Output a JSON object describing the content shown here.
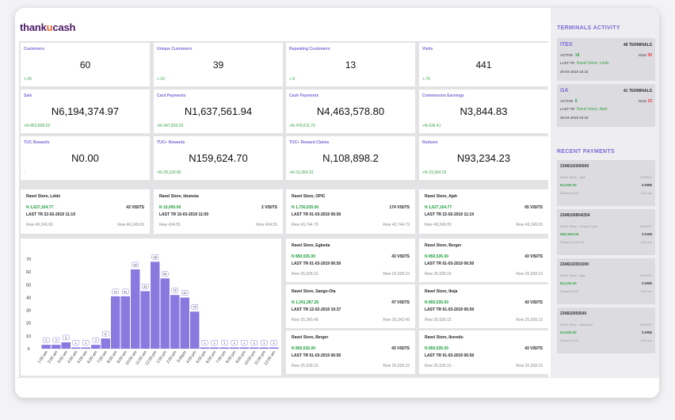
{
  "brand": {
    "logo_pre": "thank",
    "logo_mark": "u",
    "logo_post": "cash"
  },
  "stats": [
    {
      "label": "Customers",
      "value": "60",
      "change": "+.20"
    },
    {
      "label": "Unique Customers",
      "value": "39",
      "change": "+.16"
    },
    {
      "label": "Repeating Customers",
      "value": "13",
      "change": "+.9"
    },
    {
      "label": "Visits",
      "value": "441",
      "change": "+.76"
    },
    {
      "label": "Sale",
      "value": "N6,194,374.97",
      "change": "+N-853,809.02"
    },
    {
      "label": "Card Payments",
      "value": "N1,637,561.94",
      "change": "+N-347,833.03"
    },
    {
      "label": "Cash Payments",
      "value": "N4,463,578.80",
      "change": "+N-479,611.76"
    },
    {
      "label": "Commission Earnings",
      "value": "N3,844.83",
      "change": "+N-636.41"
    },
    {
      "label": "TUC Rewards",
      "value": "N0.00",
      "change": "-"
    },
    {
      "label": "TUC+ Rewards",
      "value": "N159,624.70",
      "change": "+N-28,100.90"
    },
    {
      "label": "TUC+ Reward Claims",
      "value": "N,108,898.2",
      "change": "+N-33,364.23"
    },
    {
      "label": "Redeem",
      "value": "N93,234.23",
      "change": "+N-33,364.23"
    }
  ],
  "top_stores": [
    {
      "name": "Ravel Store, Lekki",
      "amount": "N 1,627,104.77",
      "visits": "43 VISITS",
      "last": "LAST TR  22-02-2019 11:19",
      "rew_l": "Rew 49,249.00",
      "rew_r": "Rew 49,249.00"
    },
    {
      "name": "Ravel Store, Idumota",
      "amount": "N 15,000.00",
      "visits": "2 VISITS",
      "last": "LAST TR  15-03-2019 11:59",
      "rew_l": "Rew 434.55",
      "rew_r": "Rew 434.55"
    },
    {
      "name": "Ravel Store, OPIC",
      "amount": "N 1,750,535.00",
      "visits": "174 VISITS",
      "last": "LAST TR  01-03-2019 06:50",
      "rew_l": "Rew 43,744.79",
      "rew_r": "Rew 43,744.79"
    },
    {
      "name": "Ravel Store, Ajah",
      "amount": "N 1,627,104.77",
      "visits": "65 VISITS",
      "last": "LAST TR  22-02-2019 11:19",
      "rew_l": "Rew 49,249.00",
      "rew_r": "Rew 49,249.00"
    }
  ],
  "grid_stores": [
    {
      "name": "Ravel Store, Egbeda",
      "amount": "N 850,535.00",
      "visits": "43 VISITS",
      "last": "LAST TR  01-03-2019 06:50",
      "rew_l": "Rew 25,928.15",
      "rew_r": "Rew 25,928.15"
    },
    {
      "name": "Ravel Store, Berger",
      "amount": "N 850,535.00",
      "visits": "43 VISITS",
      "last": "LAST TR  01-03-2019 06:50",
      "rew_l": "Rew 25,928.15",
      "rew_r": "Rew 25,928.15"
    },
    {
      "name": "Ravel Store, Sango-Ota",
      "amount": "N 1,341,387.26",
      "visits": "47 VISITS",
      "last": "LAST TR  12-02-2019 10:37",
      "rew_l": "Rew 35,343.49",
      "rew_r": "Rew 35,343.49"
    },
    {
      "name": "Ravel Store, Ikeja",
      "amount": "N 850,535.00",
      "visits": "43 VISITS",
      "last": "LAST TR  01-03-2019 06:50",
      "rew_l": "Rew 25,928.15",
      "rew_r": "Rew 25,928.15"
    },
    {
      "name": "Ravel Store, Berger",
      "amount": "N 850,535.00",
      "visits": "43 VISITS",
      "last": "LAST TR  01-03-2019 06:50",
      "rew_l": "Rew 25,928.15",
      "rew_r": "Rew 25,928.15"
    },
    {
      "name": "Ravel Store, Ikorodu",
      "amount": "N 850,535.00",
      "visits": "43 VISITS",
      "last": "LAST TR  01-03-2019 06:50",
      "rew_l": "Rew 25,928.15",
      "rew_r": "Rew 25,928.15"
    }
  ],
  "sidebar": {
    "terminals_title": "TERMINALS ACTIVITY",
    "terminals": [
      {
        "name": "ITEX",
        "count": "48 TERMINALS",
        "active_label": "ACTIVE",
        "active": "18",
        "idle_label": "IDLE",
        "idle": "30",
        "last_label": "LAST TR",
        "last_store": "Ravel Store, Lekki",
        "date": "25-04-2019 15:32"
      },
      {
        "name": "GA",
        "count": "41 TERMINALS",
        "active_label": "ACTIVE",
        "active": "8",
        "idle_label": "IDLE",
        "idle": "33",
        "last_label": "LAST TR",
        "last_store": "Ravel Store, Ajah",
        "date": "25-04-2019 15:32"
      }
    ],
    "payments_title": "RECENT PAYMENTS",
    "payments": [
      {
        "id": "2348102000000",
        "store": "Ravel Store - Ajah",
        "date": "22/05/07",
        "amount": "N4,000.00",
        "method": "CARD",
        "reward": "Reward 0.00",
        "time": "5:32 pm"
      },
      {
        "id": "2348100854l254",
        "store": "Ravel Store - Festac Town",
        "date": "22/05/07",
        "amount": "N82,000.00",
        "method": "CASH",
        "reward": "Reward 3,037.00",
        "time": "5:32 pm"
      },
      {
        "id": "2348102001000",
        "store": "Ravel Store - Ajah",
        "date": "22/05/07",
        "amount": "N3,200.00",
        "method": "CARD",
        "reward": "Reward 0.00",
        "time": "5:32 pm"
      },
      {
        "id": "234810000540",
        "store": "Ravel Store - Maryland",
        "date": "22/05/07",
        "amount": "N3,000.00",
        "method": "CARD",
        "reward": "Reward 0.00",
        "time": "5:32 pm"
      }
    ]
  },
  "colors": {
    "accent": "#7b6bd6",
    "bar": "#8a7ae0",
    "positive": "#3aa34a",
    "negative": "#e33333"
  },
  "chart_data": {
    "type": "bar",
    "categories": [
      "1:00 am",
      "2:00 am",
      "3:00 am",
      "4:00 am",
      "5:00 am",
      "6:00 am",
      "7:00 am",
      "8:00 am",
      "9:00 am",
      "10:00 am",
      "11:00 am",
      "12:00 pm",
      "1:00 pm",
      "2:00 pm",
      "3:00pm",
      "4:00 pm",
      "5:00 pm",
      "6:00 pm",
      "7:00 pm",
      "8:00 pm",
      "9:00 pm",
      "10:00 pm",
      "11:00 pm",
      "12:00 am"
    ],
    "values": [
      3,
      3,
      5,
      1,
      1,
      3,
      8,
      41,
      41,
      62,
      45,
      68,
      55,
      42,
      40,
      29,
      1,
      1,
      1,
      1,
      1,
      1,
      1,
      1
    ],
    "yticks": [
      0,
      10,
      20,
      30,
      40,
      50,
      60,
      70
    ],
    "ylim": [
      0,
      75
    ],
    "grid": false
  }
}
